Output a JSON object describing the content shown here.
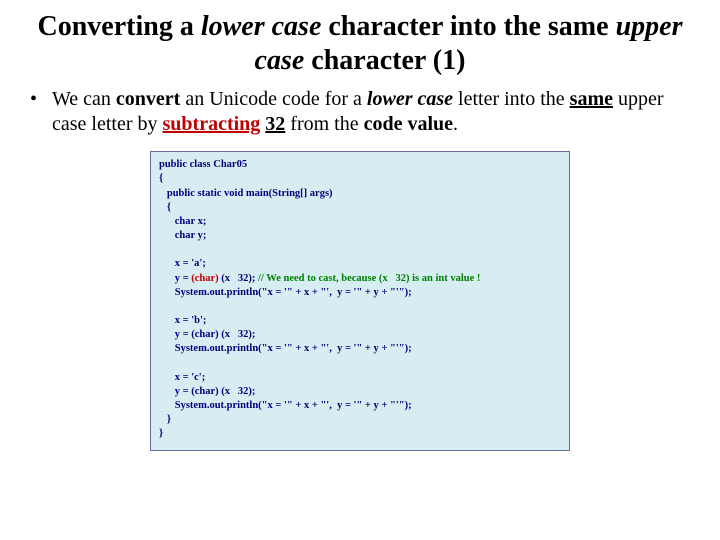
{
  "title": {
    "p1": "Converting a ",
    "p2": "lower case",
    "p3": " character into the same ",
    "p4": "upper case",
    "p5": " character (1)"
  },
  "bullet": {
    "mark": "•",
    "t1": "We can ",
    "t2": "convert",
    "t3": " an Unicode code for a ",
    "t4": "lower case",
    "t5": " letter into the ",
    "t6": "same",
    "t7": " upper case letter by ",
    "t8": "subtracting",
    "t9": " ",
    "t10": "32",
    "t11": " from the ",
    "t12": "code value",
    "t13": "."
  },
  "code": {
    "l01": "public class Char05",
    "l02": "{",
    "l03": "   public static void main(String[] args)",
    "l04": "   {",
    "l05": "      char x;",
    "l06": "      char y;",
    "l07": "",
    "l08a": "      x = 'a';",
    "l09a": "      y = ",
    "l09b": "(char)",
    "l09c": " (x   32); ",
    "l09d": "// We need to cast, because (x   32) is an int value !",
    "l10a": "      System.out.println(\"x = '\" + x + \"',  y = '\" + y + \"'\");",
    "l11": "",
    "l12a": "      x = 'b';",
    "l13a": "      y = (char) (x   32);",
    "l14a": "      System.out.println(\"x = '\" + x + \"',  y = '\" + y + \"'\");",
    "l15": "",
    "l16a": "      x = 'c';",
    "l17a": "      y = (char) (x   32);",
    "l18a": "      System.out.println(\"x = '\" + x + \"',  y = '\" + y + \"'\");",
    "l19": "   }",
    "l20": "}"
  }
}
